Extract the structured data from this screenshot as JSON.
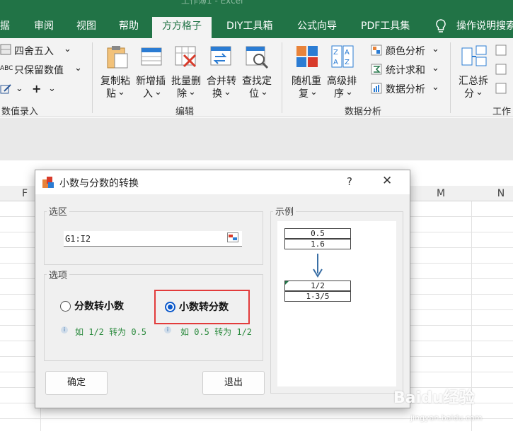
{
  "ribbon_tabs": [
    "据",
    "审阅",
    "视图",
    "帮助",
    "方方格子",
    "DIY工具箱",
    "公式向导",
    "PDF工具集",
    "操作说明搜索"
  ],
  "active_tab": "方方格子",
  "ribbon": {
    "numeric_group": {
      "label": "数值录入",
      "round_label": "四舍五入",
      "keep_value_label": "只保留数值",
      "plus_label": "+"
    },
    "edit_group": {
      "label": "编辑",
      "buttons": [
        {
          "line1": "复制粘",
          "line2": "贴"
        },
        {
          "line1": "新增插",
          "line2": "入"
        },
        {
          "line1": "批量删",
          "line2": "除"
        },
        {
          "line1": "合并转",
          "line2": "换"
        },
        {
          "line1": "查找定",
          "line2": "位"
        }
      ]
    },
    "analysis_group": {
      "label": "数据分析",
      "buttons": [
        {
          "line1": "随机重",
          "line2": "复"
        },
        {
          "line1": "高级排",
          "line2": "序"
        }
      ],
      "small_items": [
        "颜色分析",
        "统计求和",
        "数据分析"
      ]
    },
    "work_group": {
      "label": "工作",
      "button": {
        "line1": "汇总拆",
        "line2": "分"
      }
    }
  },
  "columns": [
    "F",
    "M",
    "N"
  ],
  "dialog": {
    "title": "小数与分数的转换",
    "help": "?",
    "close": "✕",
    "selection_legend": "选区",
    "range_value": "G1:I2",
    "options_legend": "选项",
    "option_frac_to_dec": "分数转小数",
    "option_dec_to_frac": "小数转分数",
    "selected_option": "dec_to_frac",
    "hint_frac_to_dec": "如 1/2 转为 0.5",
    "hint_dec_to_frac": "如 0.5 转为 1/2",
    "example_legend": "示例",
    "example": {
      "before": [
        "0.5",
        "1.6"
      ],
      "after": [
        "1/2",
        "1-3/5"
      ]
    },
    "ok_label": "确定",
    "exit_label": "退出"
  },
  "watermark": {
    "text": "Baidu经验",
    "sub": "jingyan.baidu.com"
  },
  "colors": {
    "excel_green": "#217346",
    "highlight_red": "#e23b3b",
    "radio_blue": "#0a58ca",
    "hint_green": "#2b8a3e"
  }
}
